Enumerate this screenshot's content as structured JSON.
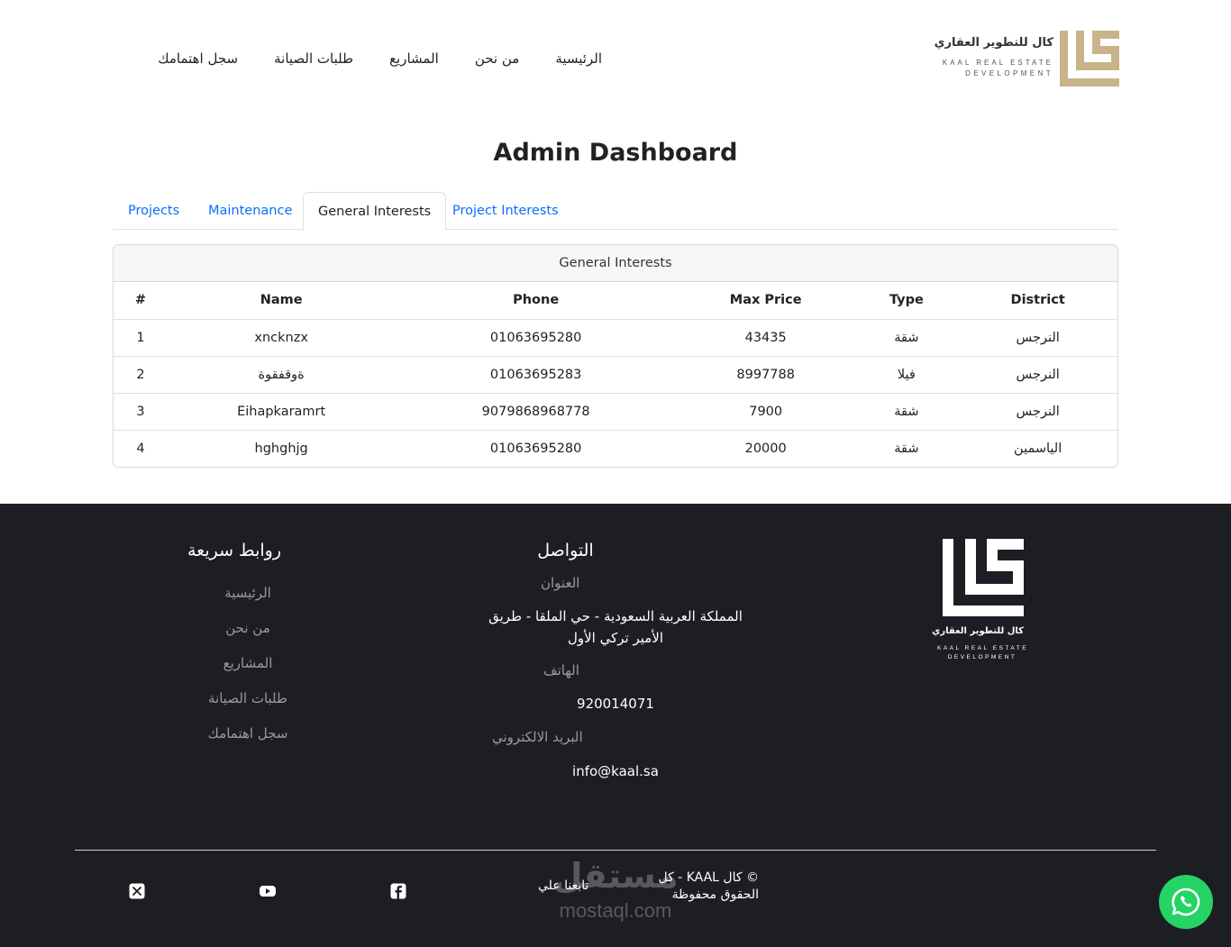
{
  "brand": {
    "name_ar": "كال للتطوير العقاري",
    "name_en_line1": "KAAL REAL ESTATE",
    "name_en_line2": "DEVELOPMENT",
    "gold": "#c9b48a"
  },
  "nav": {
    "items": [
      {
        "label": "الرئيسية"
      },
      {
        "label": "من نحن"
      },
      {
        "label": "المشاريع"
      },
      {
        "label": "طلبات الصيانة"
      },
      {
        "label": "سجل اهتمامك"
      }
    ]
  },
  "page": {
    "title": "Admin Dashboard"
  },
  "tabs": [
    {
      "label": "Projects",
      "active": false
    },
    {
      "label": "Maintenance",
      "active": false
    },
    {
      "label": "General Interests",
      "active": true
    },
    {
      "label": "Project Interests",
      "active": false
    }
  ],
  "card": {
    "title": "General Interests",
    "columns": [
      "#",
      "Name",
      "Phone",
      "Max Price",
      "Type",
      "District"
    ],
    "rows": [
      [
        "1",
        "xncknzx",
        "01063695280",
        "43435",
        "شقة",
        "النرجس"
      ],
      [
        "2",
        "ةوقفقوة",
        "01063695283",
        "8997788",
        "فيلا",
        "النرجس"
      ],
      [
        "3",
        "Eihapkaramrt",
        "9079868968778",
        "7900",
        "شقة",
        "النرجس"
      ],
      [
        "4",
        "hghghjg",
        "01063695280",
        "20000",
        "شقة",
        "الياسمين"
      ]
    ]
  },
  "footer": {
    "contact": {
      "title": "التواصل",
      "address_label": "العنوان",
      "address_value": "المملكة العربية السعودية - حي الملقا - طريق الأمير تركي الأول",
      "phone_label": "الهاتف",
      "phone_value": "920014071",
      "email_label": "البريد الالكتروني",
      "email_value": "info@kaal.sa"
    },
    "quick_links": {
      "title": "روابط سريعة",
      "items": [
        "الرئيسية",
        "من نحن",
        "المشاريع",
        "طلبات الصيانة",
        "سجل اهتمامك"
      ]
    },
    "follow_label": "تابعنا علي",
    "copyright": "© كال KAAL - كل الحقوق محفوظة",
    "social_icons": [
      "x-icon",
      "youtube-icon",
      "facebook-icon"
    ],
    "watermark_ar": "مستقل",
    "watermark_en": "mostaql.com",
    "whatsapp_color": "#25d366"
  }
}
